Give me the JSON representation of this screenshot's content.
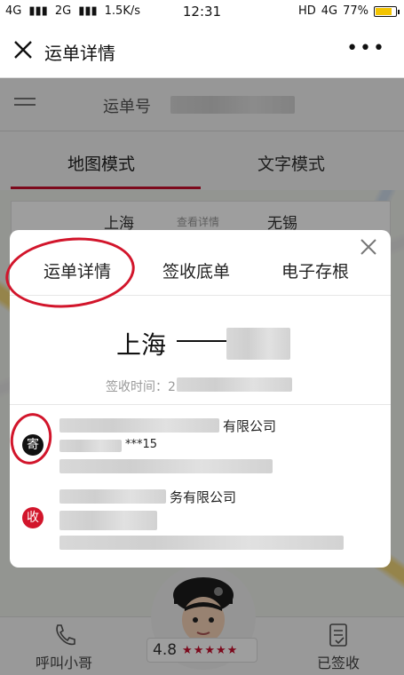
{
  "status_bar": {
    "network_1": "4G",
    "network_2": "2G",
    "speed": "1.5K/s",
    "time": "12:31",
    "hd": "HD",
    "network_3": "4G",
    "battery": "77%"
  },
  "titlebar": {
    "title": "运单详情",
    "more": "•••"
  },
  "background": {
    "waybill_label": "运单号",
    "modes": [
      "地图模式",
      "文字模式"
    ],
    "card_from": "上海",
    "card_mid": "查看详情",
    "card_to": "无锡",
    "call_label": "呼叫小哥",
    "signed_label": "已签收",
    "rating": "4.8",
    "stars": "★★★★★"
  },
  "modal": {
    "tabs": [
      "运单详情",
      "签收底单",
      "电子存根"
    ],
    "route_from": "上海",
    "sign_time_label": "签收时间：2",
    "sender_badge": "寄",
    "sender_company": "有限公司",
    "sender_phone": "***15",
    "receiver_badge": "收",
    "receiver_company": "务有限公司"
  },
  "colors": {
    "accent": "#c8102e",
    "sender_badge": "#111111",
    "receiver_badge": "#d2152b",
    "annotation": "#d2152b"
  }
}
